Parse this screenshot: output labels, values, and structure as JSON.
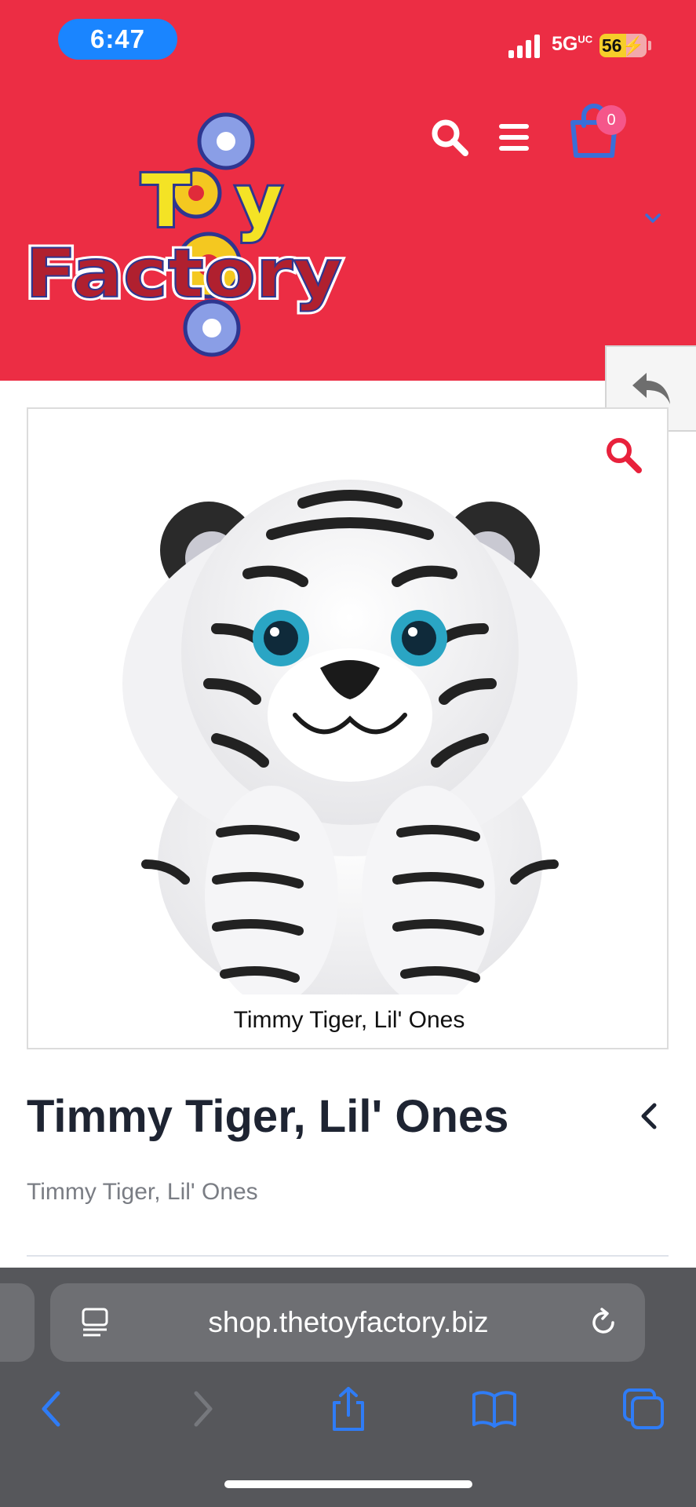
{
  "status_bar": {
    "time": "6:47",
    "network": "5G",
    "network_suffix": "UC",
    "battery": "56",
    "battery_level": 0.56
  },
  "header": {
    "logo_text": [
      "Toy",
      "Factory"
    ],
    "cart_count": "0",
    "colors": {
      "background": "#ec2d44",
      "cart_icon": "#3a6fd8",
      "badge": "#f5568a"
    },
    "icons": [
      "search-icon",
      "menu-icon",
      "cart-icon",
      "chevron-down-icon"
    ]
  },
  "gallery": {
    "image_caption": "Timmy Tiger, Lil' Ones",
    "zoom_icon_color": "#e8213c"
  },
  "product": {
    "title": "Timmy Tiger, Lil' Ones",
    "subtitle": "Timmy Tiger, Lil' Ones"
  },
  "browser": {
    "url": "shop.thetoyfactory.biz",
    "toolbar_icons": [
      "back-icon",
      "forward-icon",
      "share-icon",
      "bookmarks-icon",
      "tabs-icon"
    ],
    "accent": "#2f7cf6"
  }
}
